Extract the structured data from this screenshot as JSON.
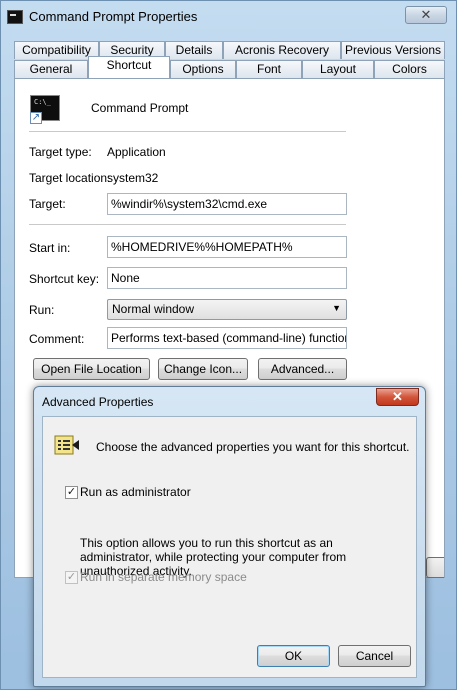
{
  "window": {
    "title": "Command Prompt Properties",
    "close": "✕"
  },
  "tabs_row1": [
    "Compatibility",
    "Security",
    "Details",
    "Acronis Recovery",
    "Previous Versions"
  ],
  "tabs_row2": [
    "General",
    "Shortcut",
    "Options",
    "Font",
    "Layout",
    "Colors"
  ],
  "active_tab": "Shortcut",
  "shortcut": {
    "app_name": "Command Prompt",
    "icon_text": "C:\\_",
    "target_type_label": "Target type:",
    "target_type_value": "Application",
    "target_location_label": "Target location:",
    "target_location_value": "system32",
    "target_label": "Target:",
    "target_value": "%windir%\\system32\\cmd.exe",
    "start_in_label": "Start in:",
    "start_in_value": "%HOMEDRIVE%%HOMEPATH%",
    "shortcut_key_label": "Shortcut key:",
    "shortcut_key_value": "None",
    "run_label": "Run:",
    "run_value": "Normal window",
    "comment_label": "Comment:",
    "comment_value": "Performs text-based (command-line) functions.",
    "open_file_location": "Open File Location",
    "change_icon": "Change Icon...",
    "advanced": "Advanced..."
  },
  "advanced_dialog": {
    "title": "Advanced Properties",
    "close": "✕",
    "heading": "Choose the advanced properties you want for this shortcut.",
    "run_as_admin_label": "Run as administrator",
    "run_as_admin_checked": true,
    "description": "This option allows you to run this shortcut as an administrator, while protecting your computer from unauthorized activity.",
    "separate_memory_label": "Run in separate memory space",
    "separate_memory_checked": true,
    "ok": "OK",
    "cancel": "Cancel",
    "check_mark": "✓"
  }
}
